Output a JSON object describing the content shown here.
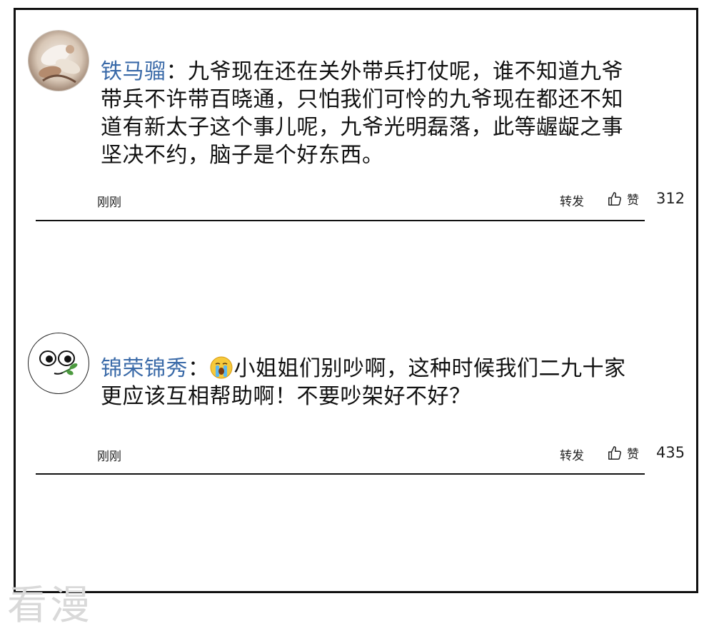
{
  "comments": [
    {
      "username": "铁马骝",
      "separator": "：",
      "text": "九爷现在还在关外带兵打仗呢，谁不知道九爷带兵不许带百晓通，只怕我们可怜的九爷现在都还不知道有新太子这个事儿呢，九爷光明磊落，此等龌龊之事坚决不约，脑子是个好东西。",
      "time": "刚刚",
      "repost_label": "转发",
      "like_label": "赞",
      "like_count": "312",
      "avatar_icon": "photo-avatar-icon"
    },
    {
      "username": "锦荣锦秀",
      "separator": "：",
      "emoji_icon": "crying-face-icon",
      "text": "小姐姐们别吵啊，这种时候我们二九十家更应该互相帮助啊！不要吵架好不好？",
      "time": "刚刚",
      "repost_label": "转发",
      "like_label": "赞",
      "like_count": "435",
      "avatar_icon": "cartoon-face-avatar-icon"
    }
  ],
  "watermark": "看漫",
  "colors": {
    "username": "#3a6aa8",
    "border": "#111111",
    "watermark": "#d9d9d9"
  }
}
